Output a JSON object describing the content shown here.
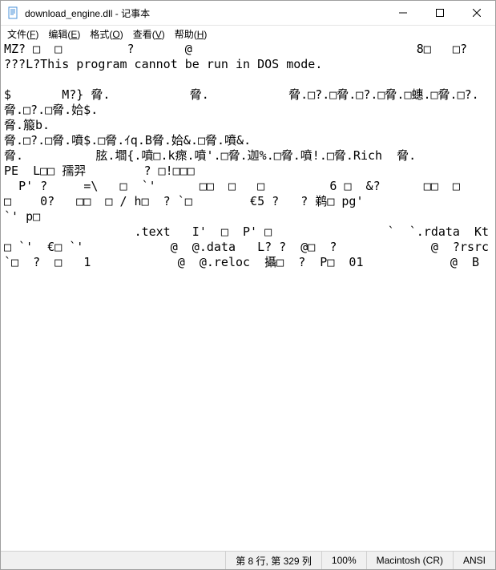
{
  "titlebar": {
    "icon_name": "notepad-icon",
    "title": "download_engine.dll - 记事本"
  },
  "menu": {
    "file": {
      "label": "文件",
      "accel": "F"
    },
    "edit": {
      "label": "编辑",
      "accel": "E"
    },
    "format": {
      "label": "格式",
      "accel": "O"
    },
    "view": {
      "label": "查看",
      "accel": "V"
    },
    "help": {
      "label": "帮助",
      "accel": "H"
    }
  },
  "content_lines": [
    "MZ? □  □         ?       @                               8□   □? ???L?This program cannot be run in DOS mode.",
    "",
    "$       M?} 脅.           脅.           脅.□?.□脅.□?.□脅.□蟪.□脅.□?.",
    "脅.□?.□脅.姶$.",
    "脅.箙b.",
    "脅.□?.□脅.噴$.□脅.ｲq.B脅.姶&.□脅.噴&.",
    "脅.          胘.壛{.噴□.k瘝.噴'.□脅.迦%.□脅.噴!.□脅.Rich  脅.                       PE  L□□ 孺羿        ? □!□□□",
    "  P' ?     =\\   □  `'      □□  □   □         6 □  &?      □□  □      □    0?   □□  □ / h□  ? `□        €5 ?   ? 鹈□ pg'                                  `' p□",
    "                  .text   I'  □  P' □                `  `.rdata  Kt□ `'  €□ `'            @  @.data   L? ?  @□  ?             @  ?rsrc   `□  ?  □   1            @  @.reloc  攝□  ?  P□  01            @  B"
  ],
  "statusbar": {
    "position": "第 8 行, 第 329 列",
    "zoom": "100%",
    "line_ending": "Macintosh (CR)",
    "encoding": "ANSI"
  }
}
